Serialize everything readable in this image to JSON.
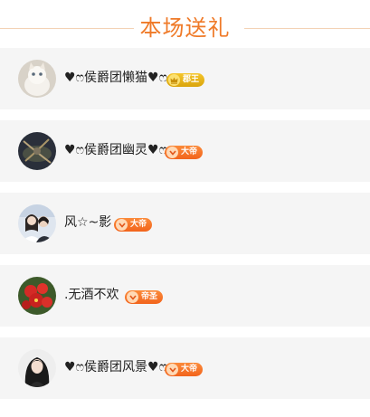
{
  "header": {
    "title": "本场送礼"
  },
  "rows": [
    {
      "name": "♥ෆ侯爵团懒猫♥ෆ",
      "badge": "郡王",
      "badge_color": "#e2b01b"
    },
    {
      "name": "♥ෆ侯爵团幽灵♥ෆ",
      "badge": "大帝",
      "badge_color": "#f46d22"
    },
    {
      "name": "风☆~影",
      "badge": "大帝",
      "badge_color": "#f46d22"
    },
    {
      "name": ".无酒不欢",
      "badge": "帝圣",
      "badge_color": "#f46d22"
    },
    {
      "name": "♥ෆ侯爵团风景♥ෆ",
      "badge": "大帝",
      "badge_color": "#f46d22"
    }
  ],
  "icons": {
    "gold_badge": "crown-icon",
    "orange_badge": "chevron-down-icon"
  }
}
